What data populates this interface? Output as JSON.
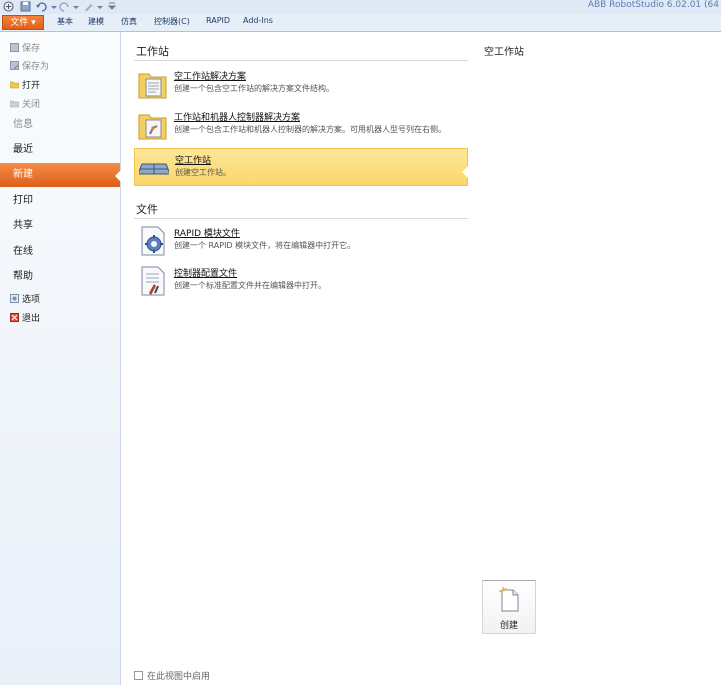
{
  "app_title": "ABB RobotStudio 6.02.01 (64",
  "ribbon_tabs": [
    "文件",
    "基本",
    "建模",
    "仿真",
    "控制器(C)",
    "RAPID",
    "Add-Ins"
  ],
  "nav": {
    "commands": [
      {
        "label": "保存",
        "icon": "save-icon"
      },
      {
        "label": "保存为",
        "icon": "save-as-icon"
      },
      {
        "label": "打开",
        "icon": "open-folder-icon"
      },
      {
        "label": "关闭",
        "icon": "close-file-icon"
      }
    ],
    "info": "信息",
    "recent": "最近",
    "new": "新建",
    "print": "打印",
    "share": "共享",
    "online": "在线",
    "help": "帮助",
    "options": "选项",
    "exit": "退出"
  },
  "workstations": {
    "title": "工作站",
    "items": [
      {
        "title": "空工作站解决方案",
        "desc": "创建一个包含空工作站的解决方案文件结构。",
        "icon": "folder-document-icon"
      },
      {
        "title": "工作站和机器人控制器解决方案",
        "desc": "创建一个包含工作站和机器人控制器的解决方案。可用机器人型号列在右侧。",
        "icon": "folder-robot-icon"
      },
      {
        "title": "空工作站",
        "desc": "创建空工作站。",
        "icon": "empty-station-icon"
      }
    ]
  },
  "files": {
    "title": "文件",
    "items": [
      {
        "title": "RAPID 模块文件",
        "desc": "创建一个 RAPID 模块文件，将在编辑器中打开它。",
        "icon": "rapid-module-icon"
      },
      {
        "title": "控制器配置文件",
        "desc": "创建一个标准配置文件并在编辑器中打开。",
        "icon": "controller-config-icon"
      }
    ]
  },
  "right_panel": {
    "title": "空工作站",
    "create_label": "创建"
  },
  "footer_option": "在此视图中启用"
}
